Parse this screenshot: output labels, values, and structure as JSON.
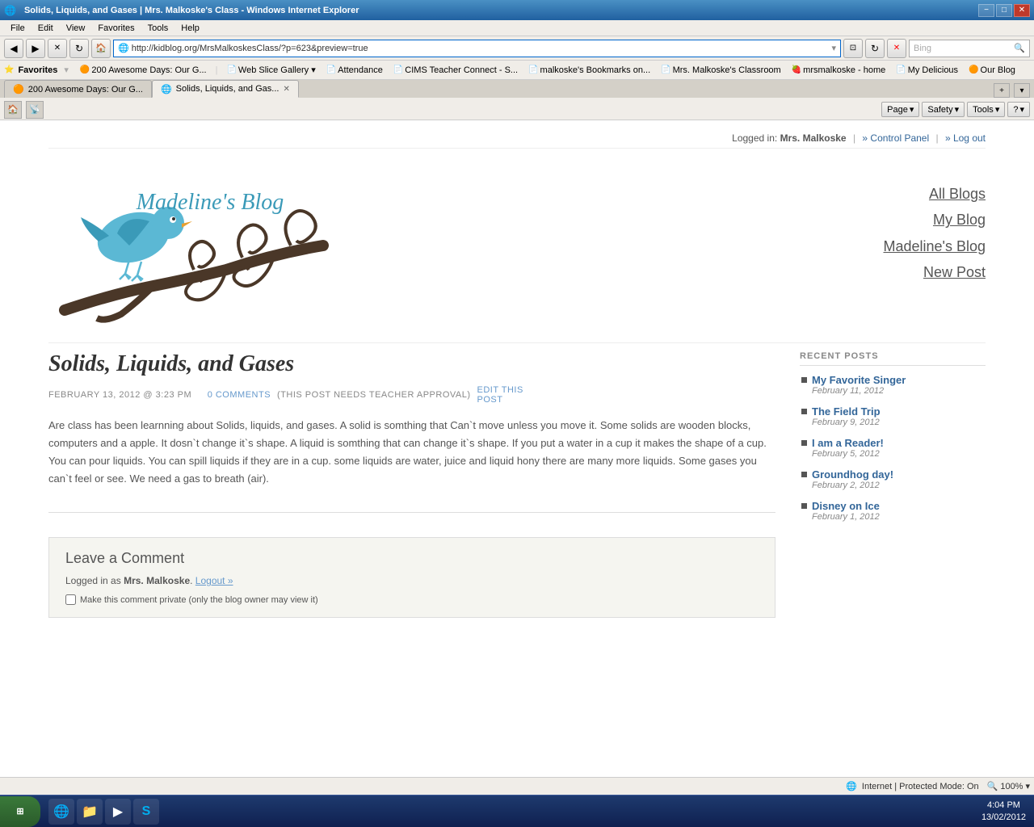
{
  "window": {
    "title": "Solids, Liquids, and Gases | Mrs. Malkoske's Class - Windows Internet Explorer"
  },
  "title_bar": {
    "title": "Solids, Liquids, and Gases | Mrs. Malkoske's Class - Windows Internet Explorer",
    "minimize": "−",
    "maximize": "□",
    "close": "✕"
  },
  "menu": {
    "items": [
      "File",
      "Edit",
      "View",
      "Favorites",
      "Tools",
      "Help"
    ]
  },
  "address": {
    "url": "http://kidblog.org/MrsMalkoskesClass/?p=623&preview=true"
  },
  "search": {
    "placeholder": "Bing"
  },
  "favorites_bar": {
    "label": "Favorites",
    "items": [
      {
        "icon": "⭐",
        "label": "200 Awesome Days: Our G..."
      },
      {
        "icon": "🌐",
        "label": "Solids, Liquids, and Gas..."
      }
    ],
    "bookmarks": [
      {
        "icon": "📄",
        "label": "Web Slice Gallery"
      },
      {
        "icon": "📄",
        "label": "Attendance"
      },
      {
        "icon": "📄",
        "label": "CIMS Teacher Connect - S..."
      },
      {
        "icon": "📄",
        "label": "malkoske's Bookmarks on..."
      },
      {
        "icon": "📄",
        "label": "Mrs. Malkoske's Classroom"
      },
      {
        "icon": "🍓",
        "label": "mrsmalkoske - home"
      },
      {
        "icon": "📄",
        "label": "My Delicious"
      },
      {
        "icon": "🟠",
        "label": "Our Blog"
      }
    ]
  },
  "tabs": [
    {
      "label": "200 Awesome Days: Our G...",
      "active": false,
      "icon": "🟠"
    },
    {
      "label": "Solids, Liquids, and Gas...",
      "active": true,
      "icon": "🌐"
    }
  ],
  "toolbar": {
    "page_label": "Page",
    "safety_label": "Safety",
    "tools_label": "Tools",
    "help_label": "?"
  },
  "login_bar": {
    "text": "Logged in:",
    "username": "Mrs. Malkoske",
    "control_panel": "» Control Panel",
    "log_out": "» Log out"
  },
  "blog": {
    "title": "Madeline's Blog",
    "nav_items": [
      "All Blogs",
      "My Blog",
      "Madeline's Blog",
      "New Post"
    ]
  },
  "post": {
    "title": "Solids, Liquids, and Gases",
    "date": "FEBRUARY 13, 2012 @ 3:23 PM",
    "comments_count": "0 COMMENTS",
    "approval_note": "(THIS POST NEEDS TEACHER APPROVAL)",
    "edit_label": "EDIT THIS POST",
    "body": "Are class has been learnning about Solids, liquids, and gases. A solid is somthing that Can`t move unless you move it. Some solids are wooden blocks, computers and a apple. It dosn`t change it`s shape. A liquid is somthing that can change it`s shape. If you put a water in a cup it makes the shape of a cup. You can pour liquids. You can spill liquids if they are in a cup. some liquids are water, juice and liquid hony there are many more liquids. Some gases you can`t feel or see. We need a gas to breath (air)."
  },
  "recent_posts": {
    "title": "RECENT POSTS",
    "items": [
      {
        "title": "My Favorite Singer",
        "date": "February 11, 2012"
      },
      {
        "title": "The Field Trip",
        "date": "February 9, 2012"
      },
      {
        "title": "I am a Reader!",
        "date": "February 5, 2012"
      },
      {
        "title": "Groundhog day!",
        "date": "February 2, 2012"
      },
      {
        "title": "Disney on Ice",
        "date": "February 1, 2012"
      }
    ]
  },
  "comment_section": {
    "title": "Leave a Comment",
    "logged_in_text": "Logged in as",
    "username": "Mrs. Malkoske",
    "logout_label": "Logout »",
    "private_label": "Make this comment private (only the blog owner may view it)"
  },
  "status_bar": {
    "internet_status": "Internet | Protected Mode: On",
    "zoom": "100%"
  },
  "taskbar": {
    "time": "4:04 PM",
    "date": "13/02/2012"
  }
}
